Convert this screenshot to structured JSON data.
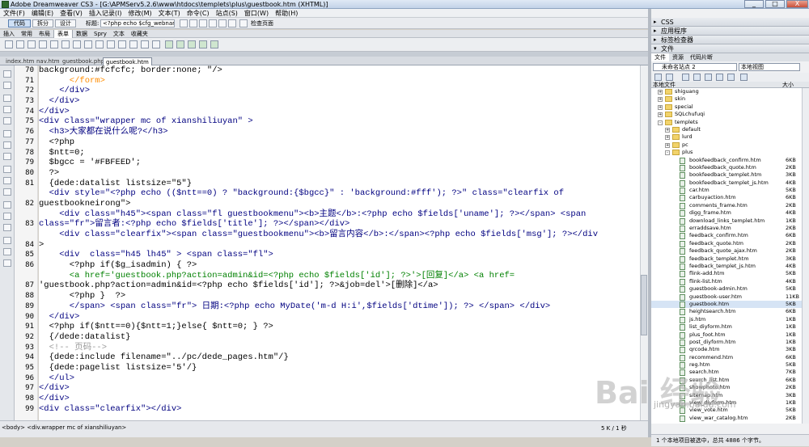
{
  "window": {
    "title": "Adobe Dreamweaver CS3 - [G:\\APMServ5.2.6\\www\\htdocs\\templets\\plus\\guestbook.htm (XHTML)]",
    "min": "_",
    "max": "□",
    "close": "X"
  },
  "menu": [
    "文件(F)",
    "编辑(E)",
    "查看(V)",
    "插入记录(I)",
    "修改(M)",
    "文本(T)",
    "命令(C)",
    "站点(S)",
    "窗口(W)",
    "帮助(H)"
  ],
  "doc_toolbar": {
    "code": "代码",
    "split": "拆分",
    "design": "设计",
    "title_label": "标题:",
    "title_value": "<?php echo $cfg_webname;",
    "check": "检查页面"
  },
  "insert_tabs": [
    "插入",
    "常用",
    "布局",
    "表单",
    "数据",
    "Spry",
    "文本",
    "收藏夹"
  ],
  "file_tabs": [
    "index.htm",
    "nav.htm",
    "guestbook.php",
    "guestbook.htm"
  ],
  "line_numbers": [
    "70",
    "71",
    "72",
    "73",
    "74",
    "75",
    "76",
    "77",
    "78",
    "79",
    "80",
    "81",
    "",
    "82",
    "",
    "83",
    "",
    "84",
    "85",
    "86",
    "",
    "87",
    "88",
    "89",
    "90",
    "91",
    "92",
    "93",
    "94",
    "95",
    "96",
    "97",
    "98",
    "99"
  ],
  "code_lines": [
    "background:#fcfcfc; border:none; \"/>",
    "      </form>",
    "    </div>",
    "  </div>",
    "</div>",
    "<div class=\"wrapper mc of xianshiliuyan\" >",
    "  <h3>大家都在说什么呢?</h3>",
    "  <?php",
    "  $ntt=0;",
    "  $bgcc = '#FBFEED';",
    "  ?>",
    "  {dede:datalist listsize=\"5\"}",
    "  <div style=\"<?php echo (($ntt==0) ? \"background:{$bgcc}\" : 'background:#fff'); ?>\" class=\"clearfix of",
    "guestbookneirong\">",
    "    <div class=\"h45\"><span class=\"fl guestbookmenu\"><b>主题</b>:<?php echo $fields['uname']; ?></span> <span",
    "class=\"fr\">留言者:<?php echo $fields['title']; ?></span></div>",
    "    <div class=\"clearfix\"><span class=\"guestbookmenu\"><b>留言内容</b>:</span><?php echo $fields['msg']; ?></div",
    ">",
    "    <div  class=\"h45 lh45\" > <span class=\"fl\">",
    "      <?php if($g_isadmin) { ?>",
    "      <a href='guestbook.php?action=admin&id=<?php echo $fields['id']; ?>'>[回复]</a> <a href=",
    "'guestbook.php?action=admin&id=<?php echo $fields['id']; ?>&job=del'>[删除]</a>",
    "      <?php }  ?>",
    "      </span> <span class=\"fr\"> 日期:<?php echo MyDate('m-d H:i',$fields['dtime']); ?> </span> </div>",
    "  </div>",
    "  <?php if($ntt==0){$ntt=1;}else{ $ntt=0; } ?>",
    "  {/dede:datalist}",
    "  <!-- 页码-->",
    "  {dede:include filename=\"../pc/dede_pages.htm\"/}",
    "  {dede:pagelist listsize='5'/}",
    "  </ul>",
    "</div>",
    "</div>",
    "<div class=\"clearfix\"></div>"
  ],
  "status": {
    "tag_path": "<body> <div.wrapper mc of xianshiliuyan>",
    "size": "5 K / 1 秒"
  },
  "panels": {
    "css": "CSS",
    "app": "应用程序",
    "tag": "标签检查器",
    "files": "文件"
  },
  "file_panel_tabs": [
    "文件",
    "资源",
    "代码片断"
  ],
  "site_select": "未命名站点 2",
  "view_select": "本地视图",
  "tree_header": {
    "name": "本地文件",
    "size": "大小"
  },
  "tree": [
    {
      "name": "shiguang",
      "type": "folder",
      "level": 1
    },
    {
      "name": "skin",
      "type": "folder",
      "level": 1
    },
    {
      "name": "special",
      "type": "folder",
      "level": 1
    },
    {
      "name": "SQLchufuqi",
      "type": "folder",
      "level": 1
    },
    {
      "name": "templets",
      "type": "folder",
      "level": 1
    },
    {
      "name": "default",
      "type": "folder",
      "level": 2
    },
    {
      "name": "lurd",
      "type": "folder",
      "level": 2
    },
    {
      "name": "pc",
      "type": "folder",
      "level": 2
    },
    {
      "name": "plus",
      "type": "folder",
      "level": 2
    },
    {
      "name": "bookfeedback_confirm.htm",
      "size": "6KB",
      "level": 3
    },
    {
      "name": "bookfeedback_quote.htm",
      "size": "2KB",
      "level": 3
    },
    {
      "name": "bookfeedback_templet.htm",
      "size": "3KB",
      "level": 3
    },
    {
      "name": "bookfeedback_templet_js.htm",
      "size": "4KB",
      "level": 3
    },
    {
      "name": "car.htm",
      "size": "5KB",
      "level": 3
    },
    {
      "name": "carbuyaction.htm",
      "size": "6KB",
      "level": 3
    },
    {
      "name": "comments_frame.htm",
      "size": "2KB",
      "level": 3
    },
    {
      "name": "digg_frame.htm",
      "size": "4KB",
      "level": 3
    },
    {
      "name": "download_links_templet.htm",
      "size": "1KB",
      "level": 3
    },
    {
      "name": "erraddsave.htm",
      "size": "2KB",
      "level": 3
    },
    {
      "name": "feedback_confirm.htm",
      "size": "6KB",
      "level": 3
    },
    {
      "name": "feedback_quote.htm",
      "size": "2KB",
      "level": 3
    },
    {
      "name": "feedback_quote_ajax.htm",
      "size": "2KB",
      "level": 3
    },
    {
      "name": "feedback_templet.htm",
      "size": "3KB",
      "level": 3
    },
    {
      "name": "feedback_templet_js.htm",
      "size": "4KB",
      "level": 3
    },
    {
      "name": "flink-add.htm",
      "size": "5KB",
      "level": 3
    },
    {
      "name": "flink-list.htm",
      "size": "4KB",
      "level": 3
    },
    {
      "name": "guestbook-admin.htm",
      "size": "5KB",
      "level": 3
    },
    {
      "name": "guestbook-user.htm",
      "size": "11KB",
      "level": 3
    },
    {
      "name": "guestbook.htm",
      "size": "5KB",
      "level": 3
    },
    {
      "name": "heightsearch.htm",
      "size": "6KB",
      "level": 3
    },
    {
      "name": "js.htm",
      "size": "1KB",
      "level": 3
    },
    {
      "name": "list_diyform.htm",
      "size": "1KB",
      "level": 3
    },
    {
      "name": "plus_foot.htm",
      "size": "1KB",
      "level": 3
    },
    {
      "name": "post_diyform.htm",
      "size": "1KB",
      "level": 3
    },
    {
      "name": "qrcode.htm",
      "size": "3KB",
      "level": 3
    },
    {
      "name": "recommend.htm",
      "size": "6KB",
      "level": 3
    },
    {
      "name": "reg.htm",
      "size": "5KB",
      "level": 3
    },
    {
      "name": "search.htm",
      "size": "7KB",
      "level": 3
    },
    {
      "name": "search_list.htm",
      "size": "6KB",
      "level": 3
    },
    {
      "name": "showphoto.htm",
      "size": "2KB",
      "level": 3
    },
    {
      "name": "sitemap.htm",
      "size": "3KB",
      "level": 3
    },
    {
      "name": "view_diyform.htm",
      "size": "1KB",
      "level": 3
    },
    {
      "name": "view_vote.htm",
      "size": "5KB",
      "level": 3
    },
    {
      "name": "view_war_catalog.htm",
      "size": "2KB",
      "level": 3
    }
  ],
  "panel_status": "1 个本地项目被选中，总共 4886 个字节。",
  "watermark": {
    "main": "Bai 经验",
    "url": "jingyan.baidu.com"
  }
}
